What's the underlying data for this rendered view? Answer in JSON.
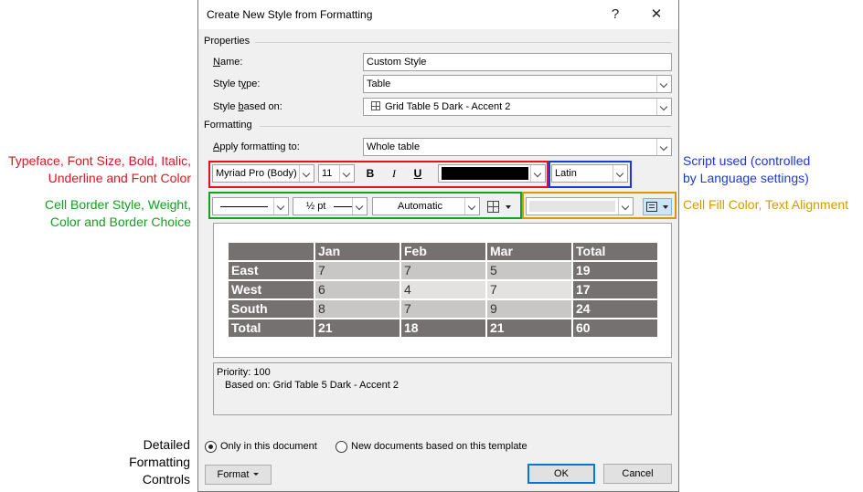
{
  "annotations": {
    "typeface": [
      "Typeface, Font Size, Bold, Italic,",
      "Underline and Font Color"
    ],
    "border": [
      "Cell Border Style, Weight,",
      "Color and Border Choice"
    ],
    "script": [
      "Script used (controlled",
      "by Language settings)"
    ],
    "fill": "Cell Fill Color, Text Alignment",
    "detailed": [
      "Detailed",
      "Formatting",
      "Controls"
    ]
  },
  "dialog": {
    "title": "Create New Style from Formatting",
    "help": "?",
    "close": "✕",
    "properties_label": "Properties",
    "name_label": "Name:",
    "name_value": "Custom Style",
    "style_type_label": "Style type:",
    "style_type_value": "Table",
    "style_based_label": "Style based on:",
    "style_based_value": "Grid Table 5 Dark - Accent 2",
    "formatting_label": "Formatting",
    "apply_label": "Apply formatting to:",
    "apply_value": "Whole table",
    "font_name": "Myriad Pro (Body)",
    "font_size": "11",
    "bold": "B",
    "italic": "I",
    "underline": "U",
    "script": "Latin",
    "border_weight": "½ pt",
    "border_color": "Automatic",
    "description_line1": "Priority: 100",
    "description_line2": "Based on: Grid Table 5 Dark - Accent 2",
    "radio_doc": "Only in this document",
    "radio_template": "New documents based on this template",
    "format_button": "Format",
    "ok_button": "OK",
    "cancel_button": "Cancel"
  },
  "preview_table": {
    "headers": [
      "",
      "Jan",
      "Feb",
      "Mar",
      "Total"
    ],
    "rows": [
      [
        "East",
        "7",
        "7",
        "5",
        "19"
      ],
      [
        "West",
        "6",
        "4",
        "7",
        "17"
      ],
      [
        "South",
        "8",
        "7",
        "9",
        "24"
      ],
      [
        "Total",
        "21",
        "18",
        "21",
        "60"
      ]
    ]
  },
  "colors": {
    "red": "#e8101f",
    "green": "#15a01f",
    "blue": "#1c39d6",
    "gold": "#d69a00",
    "table_header": "#757171",
    "table_band": "#c9c7c6",
    "ok_border": "#0078d7"
  }
}
